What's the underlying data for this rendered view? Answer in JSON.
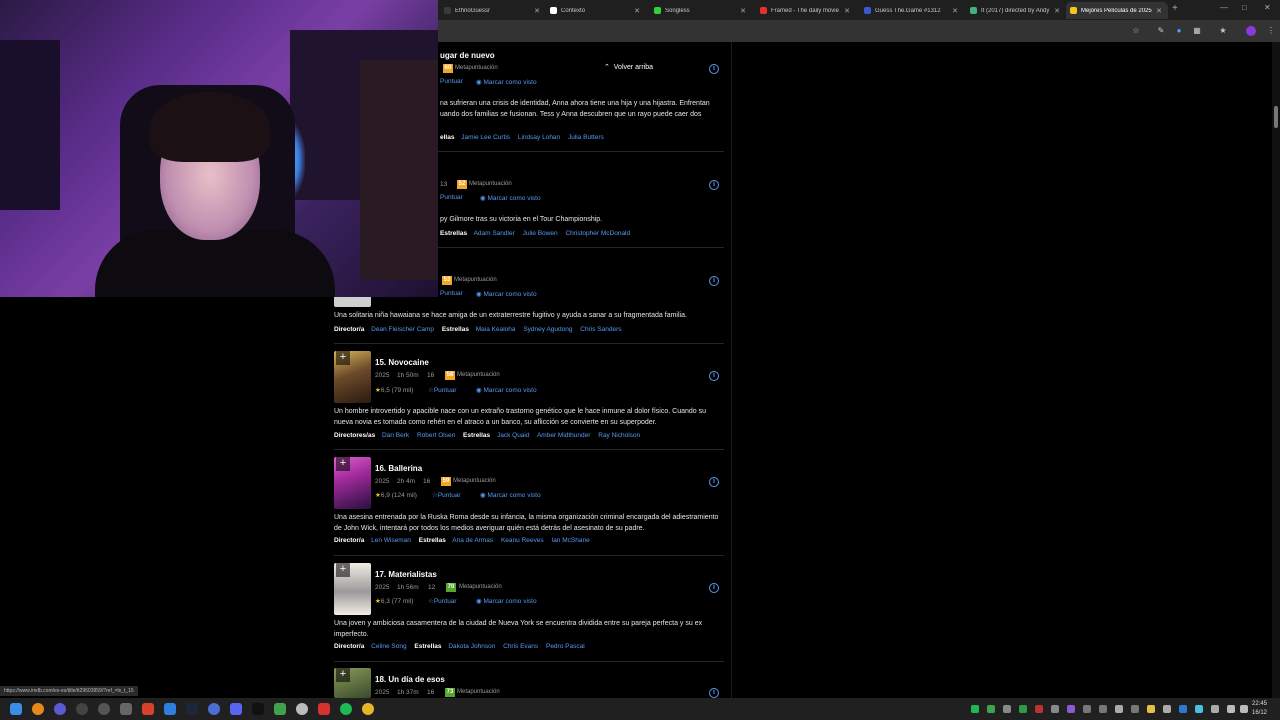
{
  "browser": {
    "tabs": [
      {
        "label": "EthnoGuessr",
        "color": "#3a3a3a"
      },
      {
        "label": "Contexto",
        "color": "#ffffff"
      },
      {
        "label": "Songless",
        "color": "#2fd13a"
      },
      {
        "label": "Framed - The daily movie",
        "color": "#e03030"
      },
      {
        "label": "Guess The.Game #1312",
        "color": "#3b57d6"
      },
      {
        "label": "It (2017) directed by Andy",
        "color": "#3fb27f"
      },
      {
        "label": "Mejores Películas de 2025",
        "color": "#f5c518"
      }
    ],
    "new_tab": "+"
  },
  "page": {
    "scroll_up_label": "Volver arriba",
    "movies": [
      {
        "title": "ugar de nuevo",
        "metascore": "60",
        "metascore_color": "#f5a623",
        "metascore_label": "Metapuntuación",
        "rate": "Puntuar",
        "watched": "Marcar como visto",
        "description": "na sufrieran una crisis de identidad, Anna ahora tiene una hija y una hijastra. Enfrentan uando dos familias se fusionan. Tess y Anna descubren que un rayo puede caer dos",
        "role2": "ellas",
        "people2": [
          "Jamie Lee Curtis",
          "Lindsay Lohan",
          "Julia Butters"
        ]
      },
      {
        "meta": "13",
        "metascore": "52",
        "metascore_color": "#f5a623",
        "metascore_label": "Metapuntuación",
        "rate": "Puntuar",
        "watched": "Marcar como visto",
        "description": "py Gilmore tras su victoria en el Tour Championship.",
        "role2": "Estrellas",
        "people2": [
          "Adam Sandler",
          "Julie Bowen",
          "Christopher McDonald"
        ]
      },
      {
        "metascore": "53",
        "metascore_color": "#f5a623",
        "metascore_label": "Metapuntuación",
        "rate": "Puntuar",
        "watched": "Marcar como visto",
        "description": "Una solitaria niña hawaiana se hace amiga de un extraterrestre fugitivo y ayuda a sanar a su fragmentada familia.",
        "role1": "Director/a",
        "people1": [
          "Dean Fleischer Camp"
        ],
        "role2": "Estrellas",
        "people2": [
          "Maia Kealoha",
          "Sydney Agudong",
          "Chris Sanders"
        ]
      },
      {
        "title": "15. Novocaine",
        "year": "2025",
        "duration": "1h 50m",
        "age": "16",
        "metascore": "58",
        "metascore_color": "#f5a623",
        "metascore_label": "Metapuntuación",
        "rating": "6,5",
        "votes": "(79 mil)",
        "rate": "Puntuar",
        "watched": "Marcar como visto",
        "description": "Un hombre introvertido y apacible nace con un extraño trastorno genético que le hace inmune al dolor físico. Cuando su nueva novia es tomada como rehén en el atraco a un banco, su aflicción se convierte en su superpoder.",
        "role1": "Directores/as",
        "people1": [
          "Dan Berk",
          "Robert Olsen"
        ],
        "role2": "Estrellas",
        "people2": [
          "Jack Quaid",
          "Amber Midthunder",
          "Ray Nicholson"
        ],
        "poster_color": "#6b4a2a"
      },
      {
        "title": "16. Ballerina",
        "year": "2025",
        "duration": "2h 4m",
        "age": "16",
        "metascore": "59",
        "metascore_color": "#f5a623",
        "metascore_label": "Metapuntuación",
        "rating": "6,9",
        "votes": "(124 mil)",
        "rate": "Puntuar",
        "watched": "Marcar como visto",
        "description": "Una asesina entrenada por la Ruska Roma desde su infancia, la misma organización criminal encargada del adiestramiento de John Wick, intentará por todos los medios averiguar quién está detrás del asesinato de su padre.",
        "role1": "Director/a",
        "people1": [
          "Len Wiseman"
        ],
        "role2": "Estrellas",
        "people2": [
          "Ana de Armas",
          "Keanu Reeves",
          "Ian McShane"
        ],
        "poster_color": "#a02a9a"
      },
      {
        "title": "17. Materialistas",
        "year": "2025",
        "duration": "1h 56m",
        "age": "12",
        "metascore": "70",
        "metascore_color": "#54a72a",
        "metascore_label": "Metapuntuación",
        "rating": "6,3",
        "votes": "(77 mil)",
        "rate": "Puntuar",
        "watched": "Marcar como visto",
        "description": "Una joven y ambiciosa casamentera de la ciudad de Nueva York se encuentra dividida entre su pareja perfecta y su ex imperfecto.",
        "role1": "Director/a",
        "people1": [
          "Celine Song"
        ],
        "role2": "Estrellas",
        "people2": [
          "Dakota Johnson",
          "Chris Evans",
          "Pedro Pascal"
        ],
        "poster_color": "#e9e4d8"
      },
      {
        "title": "18. Un día de esos",
        "year": "2025",
        "duration": "1h 37m",
        "age": "16",
        "metascore": "73",
        "metascore_color": "#54a72a",
        "metascore_label": "Metapuntuación",
        "poster_color": "#5a6a3a"
      }
    ]
  },
  "status_url": "https://www.imdb.com/es-es/title/tt29603959/?ref_=ls_t_15",
  "clock": {
    "time": "22:45",
    "date": "16/12"
  }
}
